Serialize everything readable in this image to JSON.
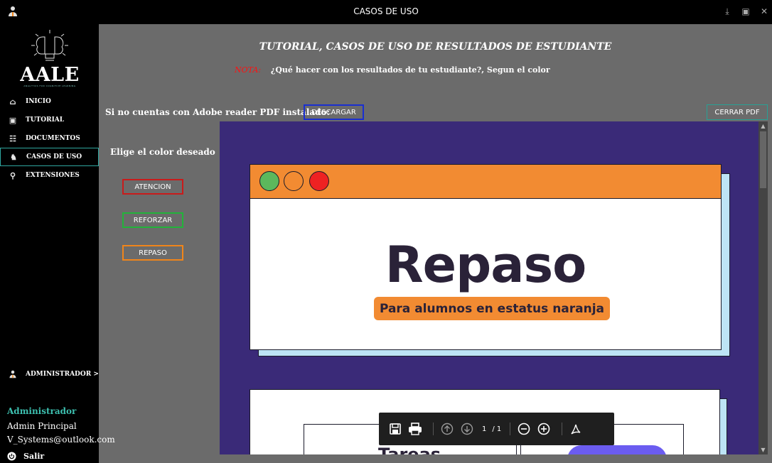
{
  "window": {
    "title": "CASOS DE USO"
  },
  "sidebar": {
    "logo_text": "AALE",
    "logo_tagline": "ANALYTICS FOR COGNITIVE LEARNING",
    "items": [
      {
        "label": "INICIO",
        "icon": "home-icon"
      },
      {
        "label": "TUTORIAL",
        "icon": "tutorial-icon"
      },
      {
        "label": "DOCUMENTOS",
        "icon": "documents-icon"
      },
      {
        "label": "CASOS DE USO",
        "icon": "cases-icon",
        "active": true
      },
      {
        "label": "EXTENSIONES",
        "icon": "search-icon"
      }
    ],
    "admin_label": "ADMINISTRADOR  >",
    "user": {
      "name": "Administrador",
      "role": "Admin Principal",
      "email": "V_Systems@outlook.com"
    },
    "logout": "Salir"
  },
  "main": {
    "heading": "TUTORIAL, CASOS DE USO DE RESULTADOS DE ESTUDIANTE",
    "note_label": "NOTA:",
    "note_text": "¿Qué hacer con los resultados de tu estudiante?, Segun el color",
    "pdf_label": "Si no cuentas con Adobe reader PDF instalado:",
    "download_button": "DESCARGAR",
    "close_pdf_button": "CERRAR PDF",
    "choose_color": "Elige el color deseado",
    "color_buttons": [
      {
        "label": "ATENCION",
        "color": "#c91b1b"
      },
      {
        "label": "REFORZAR",
        "color": "#22b33a"
      },
      {
        "label": "REPASO",
        "color": "#f0851a"
      }
    ]
  },
  "pdf": {
    "big_title": "Repaso",
    "subtitle": "Para alumnos en estatus naranja",
    "next_card_word": "Tareas",
    "page_current": "1",
    "page_total": "/ 1"
  },
  "colors": {
    "accent": "#2fa7a0",
    "viewer_bg": "#3a2a78",
    "orange": "#f28b32"
  }
}
